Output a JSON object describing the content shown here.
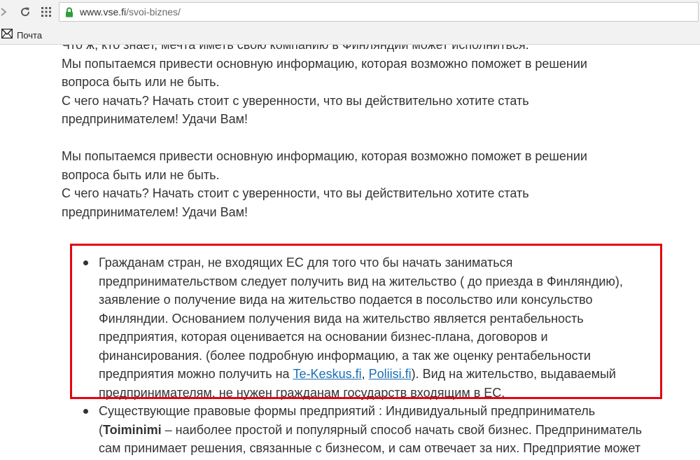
{
  "browser": {
    "url_host": "www.vse.fi",
    "url_path": "/svoi-biznes/",
    "bookmark_label": "Почта"
  },
  "content": {
    "top_partial": "Что ж, кто знает, мечта иметь свою компанию в Финляндии может исполниться.",
    "para1": [
      "Мы попытаемся привести основную информацию, которая возможно поможет в решении",
      "вопроса быть или не быть.",
      "С чего начать? Начать стоит с уверенности, что вы действительно хотите стать",
      "предпринимателем! Удачи Вам!"
    ],
    "para2": [
      "Мы попытаемся привести основную информацию, которая возможно поможет в решении",
      "вопроса быть или не быть.",
      "С чего начать? Начать стоит с уверенности, что вы действительно хотите стать",
      "предпринимателем! Удачи Вам!"
    ],
    "bullet1": {
      "lines": [
        "Гражданам стран, не входящих ЕС для того что бы начать заниматься",
        "предпринимательством следует получить вид на жительство ( до приезда в Финляндию),",
        "заявление о получение вида на жительство подается в посольство или консульство",
        "Финляндии. Основанием получения вида на жительство является рентабельность",
        "предприятия, которая оценивается на основании бизнес-плана, договоров и",
        "финансирования. (более подробную информацию, а так же оценку рентабельности"
      ],
      "line7_pre": "предприятия можно получить на ",
      "link1": "Te-Keskus.fi",
      "sep": ", ",
      "link2": "Poliisi.fi",
      "line7_post": "). Вид на жительство, выдаваемый",
      "line8": "предпринимателям, не нужен гражданам государств входящим в ЕС."
    },
    "bullet2": {
      "line1": "Существующие правовые формы предприятий : Индивидуальный предприниматель",
      "line2_pre": "(",
      "bold": "Toiminimi",
      "line2_post": " – наиболее простой и популярный способ начать свой бизнес. Предприниматель",
      "line3": "сам принимает решения, связанные с бизнесом, и сам отвечает за них. Предприятие может"
    }
  }
}
